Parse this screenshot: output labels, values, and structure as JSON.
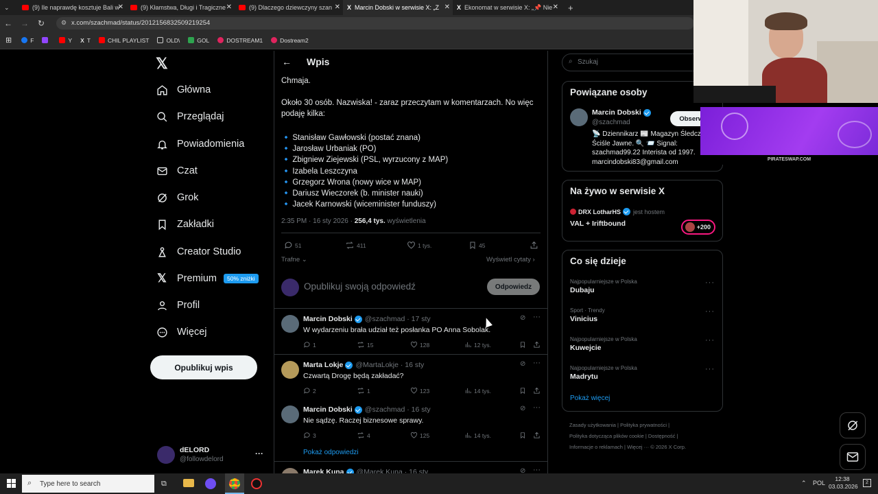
{
  "browser": {
    "tabs": [
      {
        "label": "(9) Ile naprawdę kosztuje Bali w"
      },
      {
        "label": "(9) Kłamstwa, Długi i Tragiczne"
      },
      {
        "label": "(9) Dlaczego dziewczyny szan"
      },
      {
        "label": "Marcin Dobski w serwisie X: „Z"
      },
      {
        "label": "Ekonomat w serwisie X: „📌 Nie"
      }
    ],
    "url": "x.com/szachmad/status/2012156832509219254",
    "bookmarks": [
      "F",
      "",
      "Y",
      "T",
      "CHIL PLAYLIST",
      "OLD\\",
      "GOL",
      "DOSTREAM1",
      "Dostream2"
    ]
  },
  "nav": {
    "items": [
      "Główna",
      "Przeglądaj",
      "Powiadomienia",
      "Czat",
      "Grok",
      "Zakładki",
      "Creator Studio",
      "Premium",
      "Profil",
      "Więcej"
    ],
    "premium_badge": "50% zniżki",
    "post_button": "Opublikuj wpis",
    "account": {
      "name": "dELORD",
      "handle": "@followdelord",
      "more": "···"
    }
  },
  "main": {
    "title": "Wpis",
    "text_top": "Chmaja.",
    "text_intro_1": "Około 30 osób. Nazwiska! - zaraz przeczytam w komentarzach. No więc",
    "text_intro_2": "podaję kilka:",
    "bullet": "🔹",
    "list": [
      "Stanisław Gawłowski (postać znana)",
      "Jarosław Urbaniak (PO)",
      "Zbigniew Ziejewski (PSL, wyrzucony z MAP)",
      "Izabela Leszczyna",
      "Grzegorz Wrona (nowy wice w MAP)",
      "Dariusz Wieczorek (b. minister nauki)",
      "Jacek Karnowski (wiceminister funduszy)"
    ],
    "meta_time": "2:35 PM · 16 sty 2026 · ",
    "meta_views": "256,4 tys.",
    "meta_views_label": " wyświetlenia",
    "stats": {
      "replies": "51",
      "reposts": "411",
      "likes": "1 tys.",
      "bookmarks": "45"
    },
    "sort_label": "Trafne",
    "quotes_link": "Wyświetl cytaty",
    "reply_placeholder": "Opublikuj swoją odpowiedź",
    "reply_button": "Odpowiedz",
    "replies": [
      {
        "name": "Marcin Dobski",
        "handle": "@szachmad · 17 sty",
        "text": "W wydarzeniu brała udział też posłanka PO Anna Sobolak.",
        "r": "1",
        "rt": "15",
        "l": "128",
        "v": "12 tys."
      },
      {
        "name": "Marta Lokje",
        "handle": "@MartaLokje · 16 sty",
        "text": "Czwartą Drogę będą zakładać?",
        "r": "2",
        "rt": "1",
        "l": "123",
        "v": "14 tys."
      },
      {
        "name": "Marcin Dobski",
        "handle": "@szachmad · 16 sty",
        "text": "Nie sądzę. Raczej biznesowe sprawy.",
        "r": "3",
        "rt": "4",
        "l": "125",
        "v": "14 tys."
      },
      {
        "name": "Marek Kuna",
        "handle": "@Marek Kuna · 16 sty",
        "text": "",
        "r": "",
        "rt": "",
        "l": "",
        "v": ""
      }
    ],
    "show_replies": "Pokaż odpowiedzi"
  },
  "right": {
    "search_placeholder": "Szukaj",
    "related_title": "Powiązane osoby",
    "related": {
      "name": "Marcin Dobski",
      "handle": "@szachmad",
      "follow": "Obserwuj",
      "bio_1": "📡 Dziennikarz 📰 Magazyn Śledczy",
      "bio_2": "Ściśle Jawne. 🔍 📨 Signal:",
      "bio_3": "szachmad99.22 Interista od 1997.",
      "bio_4": "marcindobski83@gmail.com"
    },
    "live_title": "Na żywo w serwisie X",
    "live": {
      "host": "DRX LotharHS",
      "host_suffix": "jest hostem",
      "title": "VAL + Iriftbound",
      "count": "+200"
    },
    "trends_title": "Co się dzieje",
    "trends": [
      {
        "context": "Najpopularniejsze w Polska",
        "topic": "Dubaju"
      },
      {
        "context": "Sport · Trendy",
        "topic": "Vinicius"
      },
      {
        "context": "Najpopularniejsze w Polska",
        "topic": "Kuwejcie"
      },
      {
        "context": "Najpopularniejsze w Polska",
        "topic": "Madrytu"
      }
    ],
    "show_more": "Pokaż więcej",
    "footer_1": "Zasady użytkowania  |  Polityka prywatności  |",
    "footer_2": "Polityka dotycząca plików cookie  |  Dostępność  |",
    "footer_3": "Informacje o reklamach  |  Więcej ···  © 2026 X Corp."
  },
  "overlay": {
    "sponsor": "PIRATESWAP.COM"
  },
  "taskbar": {
    "search_placeholder": "Type here to search",
    "lang": "POL",
    "time": "12:38",
    "date": "03.03.2026",
    "notif": "2"
  },
  "colors": {
    "accent": "#1d9bf0",
    "bg": "#000000",
    "border": "#2f3336",
    "muted": "#71767b",
    "premium": "#1d9bf0"
  }
}
